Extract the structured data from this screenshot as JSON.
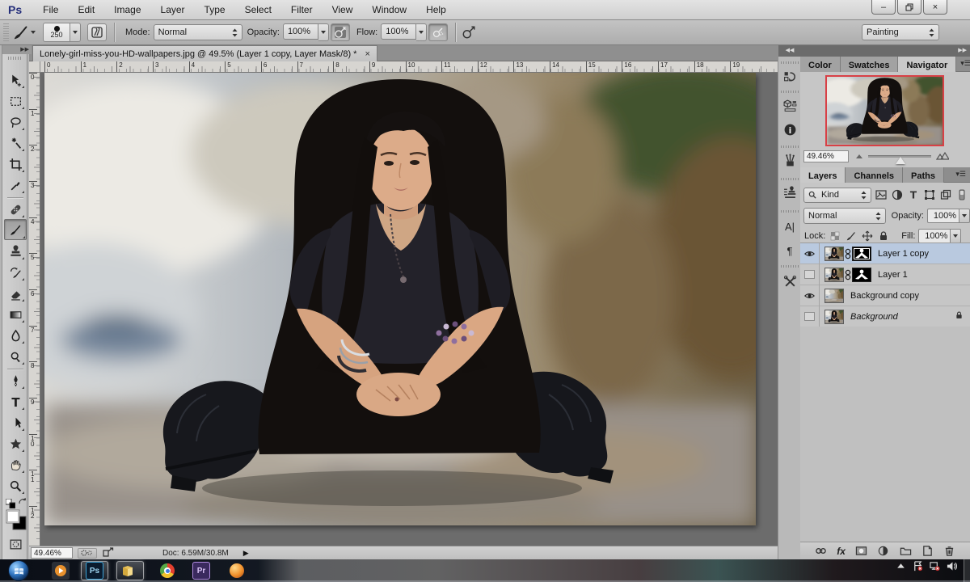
{
  "app": {
    "logo": "Ps"
  },
  "menu": {
    "items": [
      "File",
      "Edit",
      "Image",
      "Layer",
      "Type",
      "Select",
      "Filter",
      "View",
      "Window",
      "Help"
    ]
  },
  "window_controls": {
    "minimize": "–",
    "close": "×"
  },
  "options": {
    "brush_size": "250",
    "mode_label": "Mode:",
    "mode_value": "Normal",
    "opacity_label": "Opacity:",
    "opacity_value": "100%",
    "flow_label": "Flow:",
    "flow_value": "100%",
    "workspace": "Painting"
  },
  "document": {
    "tab_title": "Lonely-girl-miss-you-HD-wallpapers.jpg @ 49.5% (Layer 1 copy, Layer Mask/8) *",
    "close_label": "×"
  },
  "rulers": {
    "horizontal": [
      "0",
      "1",
      "2",
      "3",
      "4",
      "5",
      "6",
      "7",
      "8",
      "9",
      "10",
      "11",
      "12",
      "13",
      "14",
      "15",
      "16",
      "17",
      "18",
      "19"
    ],
    "vertical": [
      "0",
      "1",
      "2",
      "3",
      "4",
      "5",
      "6",
      "7",
      "8",
      "9",
      "10",
      "11",
      "12"
    ]
  },
  "tools": [
    "move",
    "rectangular-marquee",
    "lasso",
    "magic-wand",
    "crop",
    "eyedropper",
    "spot-healing-brush",
    "brush",
    "clone-stamp",
    "history-brush",
    "eraser",
    "gradient",
    "blur",
    "dodge",
    "pen",
    "type",
    "path-selection",
    "custom-shape",
    "hand",
    "zoom"
  ],
  "panels": {
    "nav_tabs": [
      "Color",
      "Swatches",
      "Navigator"
    ],
    "navigator": {
      "zoom": "49.46%"
    },
    "layer_tabs": [
      "Layers",
      "Channels",
      "Paths"
    ],
    "layers_panel": {
      "kind_label": "Kind",
      "blend_mode": "Normal",
      "opacity_label": "Opacity:",
      "opacity_value": "100%",
      "lock_label": "Lock:",
      "fill_label": "Fill:",
      "fill_value": "100%",
      "items": [
        {
          "name": "Layer 1 copy",
          "visible": true,
          "selected": true,
          "has_mask": true,
          "locked": false
        },
        {
          "name": "Layer 1",
          "visible": false,
          "selected": false,
          "has_mask": true,
          "locked": false
        },
        {
          "name": "Background copy",
          "visible": true,
          "selected": false,
          "has_mask": false,
          "locked": false
        },
        {
          "name": "Background",
          "visible": false,
          "selected": false,
          "has_mask": false,
          "locked": true
        }
      ]
    }
  },
  "status": {
    "zoom": "49.46%",
    "doc": "Doc: 6.59M/30.8M"
  },
  "taskbar": {
    "items": [
      "start",
      "media-player",
      "photoshop",
      "file-explorer",
      "chrome",
      "premiere",
      "firefox"
    ],
    "badges": {
      "photoshop": "Ps",
      "premiere": "Pr"
    }
  },
  "colors": {
    "selection_row": "#b9c9df",
    "navigator_border": "#d84046",
    "ps_logo": "#242e7a",
    "premiere": "#3a2a5e"
  }
}
